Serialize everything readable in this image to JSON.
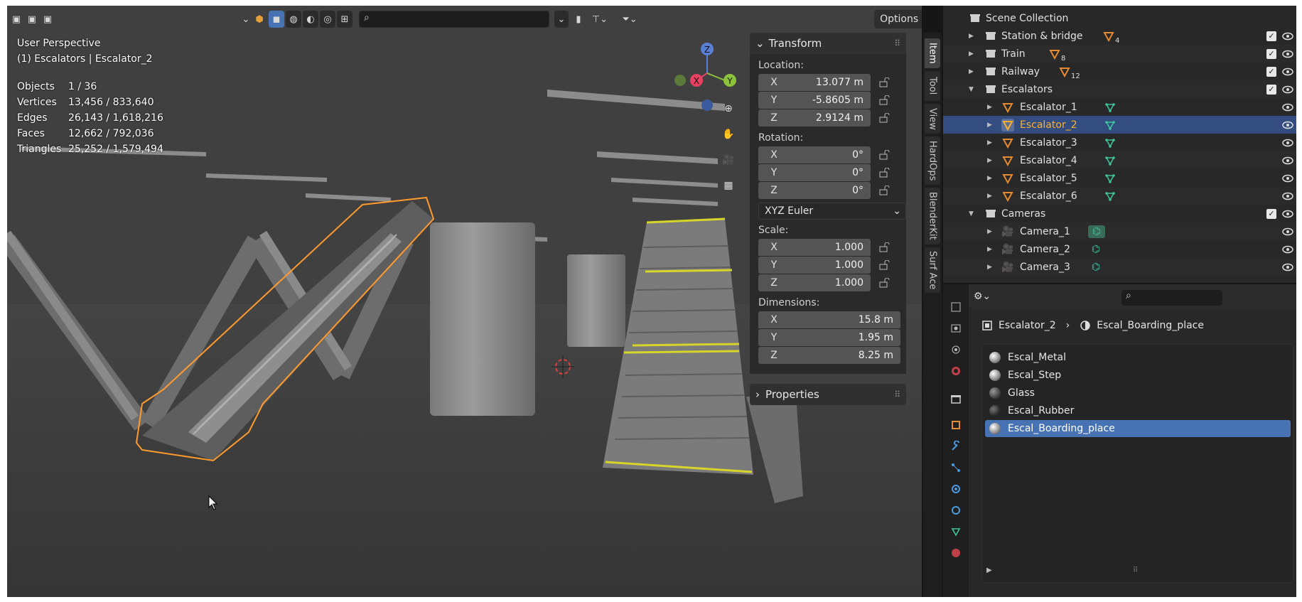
{
  "viewport": {
    "mode_label": "User Perspective",
    "context_label": "(1) Escalators | Escalator_2",
    "stats": [
      {
        "key": "Objects",
        "value": "1 / 36"
      },
      {
        "key": "Vertices",
        "value": "13,456 / 833,640"
      },
      {
        "key": "Edges",
        "value": "26,143 / 1,618,216"
      },
      {
        "key": "Faces",
        "value": "12,662 / 792,036"
      },
      {
        "key": "Triangles",
        "value": "25,252 / 1,579,494"
      }
    ],
    "options_label": "Options",
    "gizmo": {
      "z": "Z",
      "x": "X",
      "y": "Y"
    },
    "accent": "#4772b3",
    "selection_color": "#ff9a2e"
  },
  "npanel": {
    "transform_title": "Transform",
    "location_label": "Location:",
    "location": [
      {
        "axis": "X",
        "value": "13.077 m"
      },
      {
        "axis": "Y",
        "value": "-5.8605 m"
      },
      {
        "axis": "Z",
        "value": "2.9124 m"
      }
    ],
    "rotation_label": "Rotation:",
    "rotation": [
      {
        "axis": "X",
        "value": "0°"
      },
      {
        "axis": "Y",
        "value": "0°"
      },
      {
        "axis": "Z",
        "value": "0°"
      }
    ],
    "rotation_mode": "XYZ Euler",
    "scale_label": "Scale:",
    "scale": [
      {
        "axis": "X",
        "value": "1.000"
      },
      {
        "axis": "Y",
        "value": "1.000"
      },
      {
        "axis": "Z",
        "value": "1.000"
      }
    ],
    "dimensions_label": "Dimensions:",
    "dimensions": [
      {
        "axis": "X",
        "value": "15.8 m"
      },
      {
        "axis": "Y",
        "value": "1.95 m"
      },
      {
        "axis": "Z",
        "value": "8.25 m"
      }
    ],
    "properties_title": "Properties"
  },
  "side_tabs": [
    "Item",
    "Tool",
    "View",
    "HardOps",
    "BlenderKit",
    "Surf Ace"
  ],
  "outliner": {
    "root": "Scene Collection",
    "rows": [
      {
        "name": "Station & bridge",
        "badge": "4"
      },
      {
        "name": "Train",
        "badge": "8"
      },
      {
        "name": "Railway",
        "badge": "12"
      },
      {
        "name": "Escalators"
      },
      {
        "name": "Escalator_1"
      },
      {
        "name": "Escalator_2"
      },
      {
        "name": "Escalator_3"
      },
      {
        "name": "Escalator_4"
      },
      {
        "name": "Escalator_5"
      },
      {
        "name": "Escalator_6"
      },
      {
        "name": "Cameras"
      },
      {
        "name": "Camera_1"
      },
      {
        "name": "Camera_2"
      },
      {
        "name": "Camera_3"
      }
    ]
  },
  "properties": {
    "breadcrumb_object": "Escalator_2",
    "breadcrumb_material": "Escal_Boarding_place",
    "materials": [
      "Escal_Metal",
      "Escal_Step",
      "Glass",
      "Escal_Rubber",
      "Escal_Boarding_place"
    ],
    "selected_material": "Escal_Boarding_place"
  }
}
